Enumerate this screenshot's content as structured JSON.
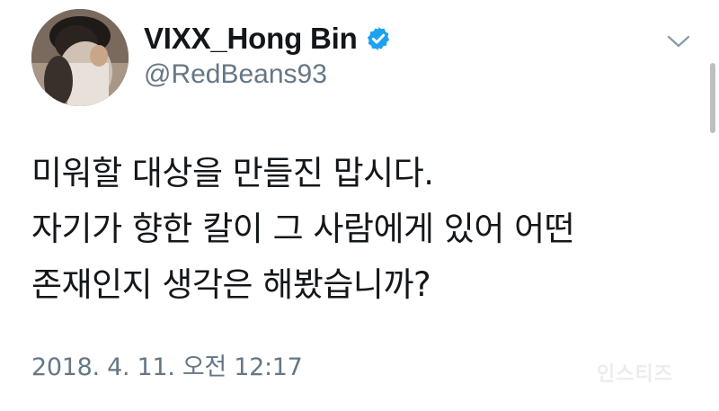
{
  "tweet": {
    "display_name": "VIXX_Hong Bin",
    "handle": "@RedBeans93",
    "verified": true,
    "avatar_icon": "profile-photo",
    "more_icon": "chevron-down-icon",
    "text_lines": [
      "미워할 대상을 만들진 맙시다.",
      "자기가 향한 칼이 그 사람에게 있어 어떤",
      "존재인지 생각은 해봤습니까?"
    ],
    "timestamp": "2018. 4. 11. 오전 12:17",
    "watermark": "인스티즈"
  },
  "colors": {
    "text": "#14171a",
    "secondary": "#657786",
    "verified_badge": "#1da1f2",
    "background": "#ffffff"
  }
}
